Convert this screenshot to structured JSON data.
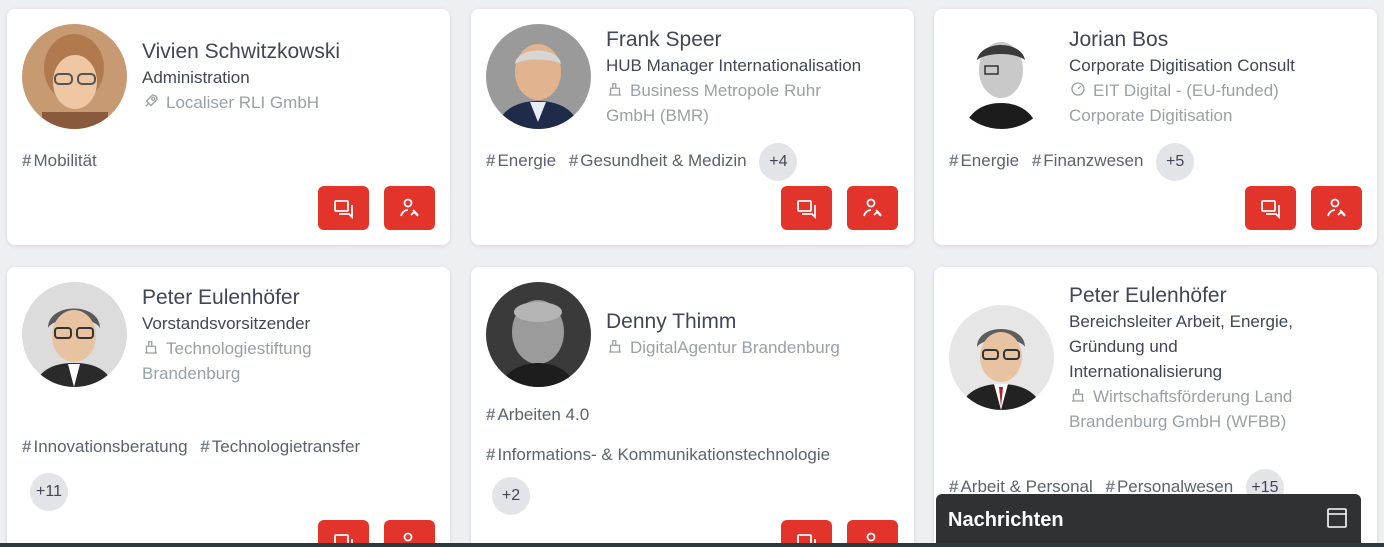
{
  "cards": [
    {
      "name": "Vivien Schwitzkowski",
      "role": "Administration",
      "org_icon": "rocket-icon",
      "org_lines": [
        "Localiser RLI GmbH"
      ],
      "tags": [
        "Mobilität"
      ],
      "more": ""
    },
    {
      "name": "Frank Speer",
      "role": "HUB Manager Internationalisation",
      "org_icon": "building-icon",
      "org_lines": [
        "Business Metropole Ruhr",
        "GmbH (BMR)"
      ],
      "tags": [
        "Energie",
        "Gesundheit & Medizin"
      ],
      "more": "+4"
    },
    {
      "name": "Jorian Bos",
      "role": "Corporate Digitisation Consult",
      "org_icon": "gauge-icon",
      "org_lines": [
        "EIT Digital - (EU-funded)",
        "Corporate Digitisation"
      ],
      "tags": [
        "Energie",
        "Finanzwesen"
      ],
      "more": "+5"
    },
    {
      "name": "Peter Eulenhöfer",
      "role": "Vorstandsvorsitzender",
      "org_icon": "building-icon",
      "org_lines": [
        "Technologiestiftung",
        "Brandenburg"
      ],
      "tags": [
        "Innovationsberatung",
        "Technologietransfer"
      ],
      "more": "+11"
    },
    {
      "name": "Denny Thimm",
      "role": "",
      "org_icon": "building-icon",
      "org_lines": [
        "DigitalAgentur Brandenburg"
      ],
      "tags": [
        "Arbeiten 4.0",
        "Informations- & Kommunikationstechnologie"
      ],
      "more": "+2"
    },
    {
      "name": "Peter Eulenhöfer",
      "role_lines": [
        "Bereichsleiter Arbeit, Energie,",
        "Gründung und",
        "Internationalisierung"
      ],
      "org_icon": "building-icon",
      "org_lines": [
        "Wirtschaftsförderung Land",
        "Brandenburg GmbH (WFBB)"
      ],
      "tags": [
        "Arbeit & Personal",
        "Personalwesen"
      ],
      "more": "+15"
    }
  ],
  "buttons": {
    "message": "chat-icon",
    "contact": "user-handshake-icon"
  },
  "chat_widget": {
    "title": "Nachrichten",
    "toggle_icon": "window-icon"
  },
  "colors": {
    "accent": "#e3342c",
    "background": "#eeeff2",
    "card": "#ffffff",
    "chat_bar": "#2f3133"
  }
}
